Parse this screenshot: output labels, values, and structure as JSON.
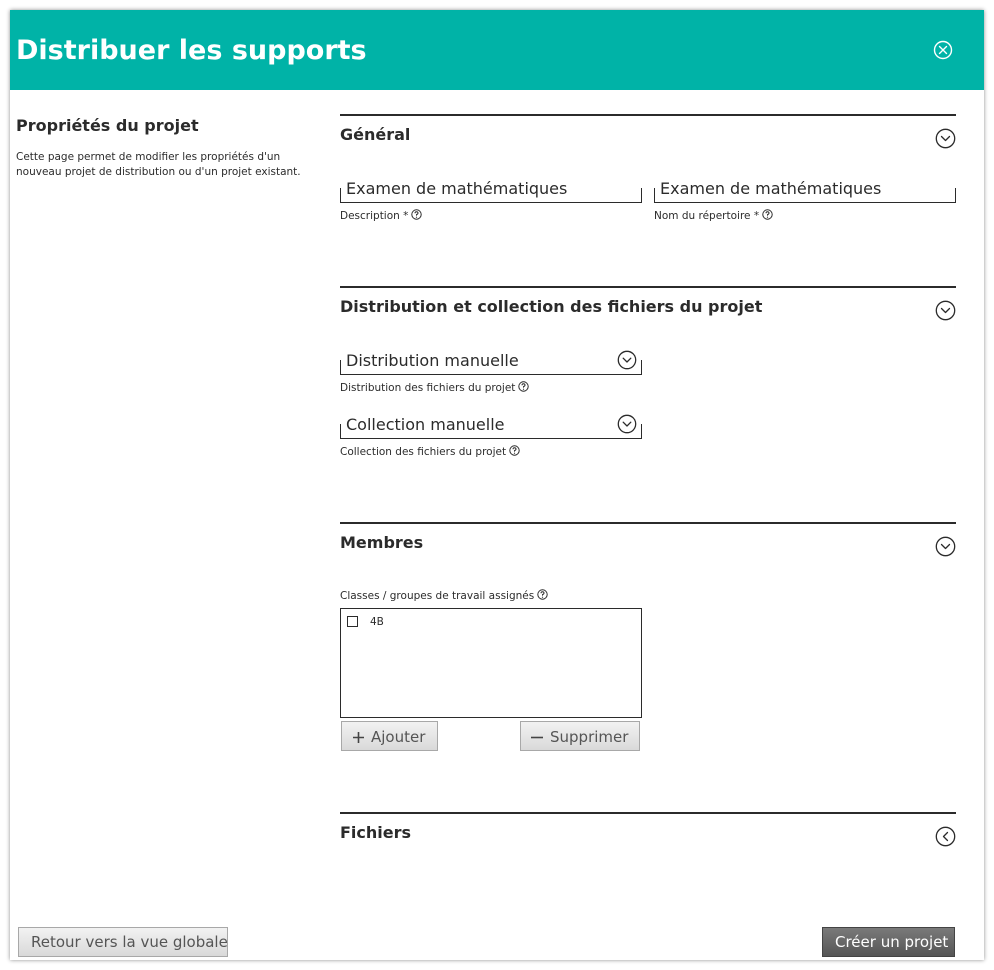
{
  "header": {
    "title": "Distribuer les supports"
  },
  "sidebar": {
    "title": "Propriétés du projet",
    "description": "Cette page permet de modifier les propriétés d'un nouveau projet de distribution ou d'un projet existant."
  },
  "sections": {
    "general": {
      "title": "Général",
      "description_value": "Examen de mathématiques",
      "description_label": "Description *",
      "directory_value": "Examen de mathématiques",
      "directory_label": "Nom du répertoire *"
    },
    "distribution": {
      "title": "Distribution et collection des fichiers du projet",
      "distribution_value": "Distribution manuelle",
      "distribution_label": "Distribution des fichiers du projet",
      "collection_value": "Collection manuelle",
      "collection_label": "Collection des fichiers du projet"
    },
    "members": {
      "title": "Membres",
      "list_label": "Classes / groupes de travail assignés",
      "items": [
        {
          "label": "4B",
          "checked": false
        }
      ],
      "add_label": "Ajouter",
      "remove_label": "Supprimer"
    },
    "files": {
      "title": "Fichiers"
    }
  },
  "footer": {
    "back_label": "Retour vers la vue globale",
    "create_label": "Créer un projet"
  },
  "colors": {
    "header": "#00b3a7",
    "text": "#2b2b2b",
    "button_dark": "#5f5f5f"
  },
  "icons": {
    "close": "close-circle-icon",
    "expand": "chevron-down-circle-icon",
    "collapsed": "chevron-left-circle-icon",
    "help": "help-circle-icon",
    "add": "plus-icon",
    "remove": "minus-icon"
  }
}
